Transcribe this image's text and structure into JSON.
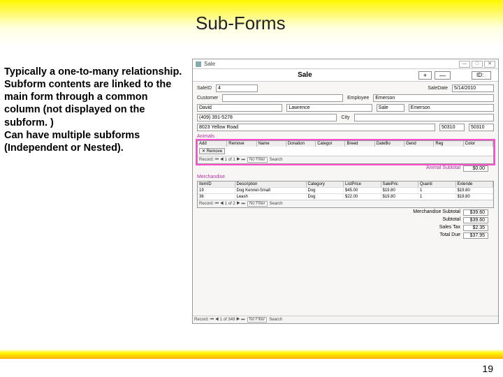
{
  "slide": {
    "title": "Sub-Forms",
    "body_text": "Typically a one-to-many relationship.\nSubform contents are linked to the main form through a common column (not displayed on the subform. )\nCan have multiple subforms (Independent or Nested).",
    "page_number": "19"
  },
  "window": {
    "title": "Sale",
    "controls": {
      "min": "—",
      "max": "□",
      "close": "✕"
    },
    "form_header": {
      "title": "Sale",
      "plus": "+",
      "minus": "—",
      "id_box": "ID:"
    },
    "fields": {
      "sale_id_label": "SaleID",
      "sale_id_value": "4",
      "sale_date_label": "SaleDate",
      "sale_date_value": "5/14/2010",
      "customer_label": "Customer",
      "employee_label": "Employee",
      "first_name": "David",
      "last_name": "Lawrence",
      "emp_code": "Sale",
      "emp_name": "Emerson",
      "phone": "(409) 391-5278",
      "city_label": "City",
      "addr": "8023 Yellow Road",
      "zip1": "50310",
      "zip2": "50310"
    },
    "animals_section": "Animals",
    "animals_subform": {
      "buttons": {
        "add": "+ Add",
        "remove": "✕ Remove"
      },
      "headers": [
        "Add",
        "Remove",
        "Name",
        "Donation",
        "Categor",
        "Breed",
        "DateBo",
        "Gend",
        "Reg",
        "Color"
      ],
      "row_remove_btn": "✕ Remove",
      "recnav": {
        "label": "Record: ⏮ ◀ 1 of 1 ▶ ⏭",
        "nofilter": "No Filter",
        "search": "Search"
      }
    },
    "animals_total": {
      "label": "Animal Subtotal",
      "value": "$0.00"
    },
    "merch_label": "Merchandise",
    "merch_subform": {
      "headers": [
        "ItemID",
        "Description",
        "Category",
        "ListPrice",
        "SalePric",
        "Quanti",
        "Extende"
      ],
      "rows": [
        [
          "19",
          "Dog Kennel-Small",
          "Dog",
          "$45.00",
          "$19.80",
          "1",
          "$19.80"
        ],
        [
          "36",
          "Leash",
          "Dog",
          "$22.00",
          "$19.80",
          "1",
          "$19.80"
        ]
      ],
      "recnav": {
        "label": "Record: ⏮ ◀ 1 of 2 ▶ ⏭",
        "nofilter": "No Filter",
        "search": "Search"
      }
    },
    "totals": [
      {
        "label": "Merchandise Subtotal",
        "value": "$39.60"
      },
      {
        "label": "Subtotal",
        "value": "$39.60"
      },
      {
        "label": "Sales Tax",
        "value": "$2.35"
      },
      {
        "label": "Total Due",
        "value": "$37.95"
      }
    ],
    "main_recnav": {
      "label": "Record: ⏮ ◀ 1 of 349 ▶ ⏭",
      "nofilter": "No Filter",
      "search": "Search"
    }
  }
}
